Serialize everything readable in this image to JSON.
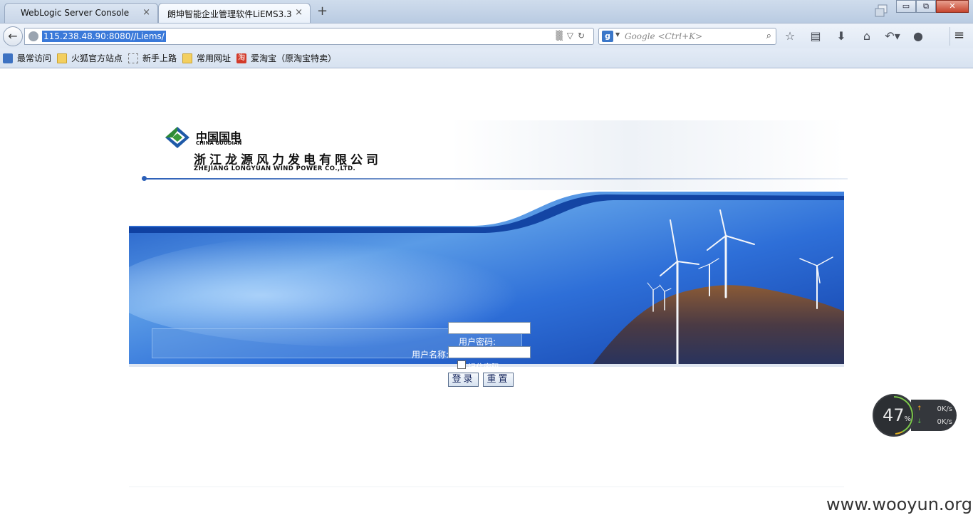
{
  "browser": {
    "tabs": [
      {
        "label": "WebLogic Server Console",
        "close": "×"
      },
      {
        "label": "朗坤智能企业管理软件LiEMS3.3",
        "close": "×"
      }
    ],
    "new_tab": "+",
    "url": "115.238.48.90:8080//Liems/",
    "search_placeholder": "Google <Ctrl+K>",
    "search_engine_letter": "g",
    "window_buttons": {
      "minimize": "▭",
      "restore": "⧉",
      "close": "✕"
    }
  },
  "bookmarks": [
    {
      "label": "最常访问",
      "icon": "most-visited-icon"
    },
    {
      "label": "火狐官方站点",
      "icon": "folder-icon"
    },
    {
      "label": "新手上路",
      "icon": "dotted-page-icon"
    },
    {
      "label": "常用网址",
      "icon": "folder-icon"
    },
    {
      "label": "爱淘宝（原淘宝特卖）",
      "icon": "taobao-icon",
      "badge": "淘"
    }
  ],
  "header": {
    "brand_cn": "中国国电",
    "brand_en": "CHINA GUODIAN",
    "company_cn": "浙江龙源风力发电有限公司",
    "company_en": "ZHEJIANG LONGYUAN WIND POWER CO.,LTD."
  },
  "login": {
    "password_label": "用户密码:",
    "username_label": "用户名称:",
    "remember_label": "记住密码",
    "login_button": "登录",
    "reset_button": "重置"
  },
  "net_widget": {
    "percent": "47",
    "percent_sign": "%",
    "upload": "0K/s",
    "download": "0K/s"
  },
  "watermark": "www.wooyun.org",
  "colors": {
    "accent": "#2b5fb8",
    "banner_blue": "#1e5fc7",
    "url_highlight": "#3a79d9"
  }
}
